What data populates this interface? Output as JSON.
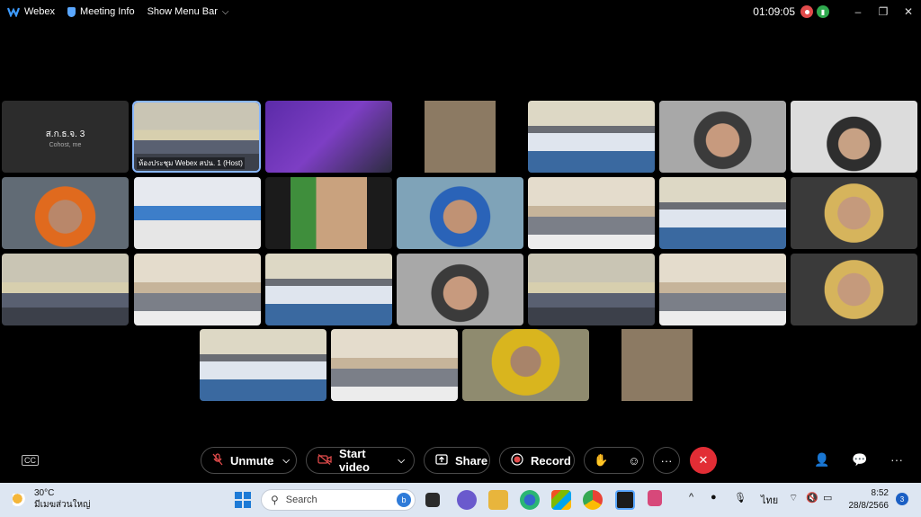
{
  "titlebar": {
    "app_name": "Webex",
    "meeting_info": "Meeting Info",
    "show_menu": "Show Menu Bar",
    "timer": "01:09:05",
    "minimize": "–",
    "restore": "❐",
    "close": "✕"
  },
  "tiles": {
    "self": {
      "name": "ส.ก.ธ.จ. 3",
      "role": "Cohost, me"
    },
    "host": {
      "label": "ห้องประชุม Webex สปน. 1 (Host)"
    }
  },
  "controls": {
    "unmute": "Unmute",
    "start_video": "Start video",
    "share": "Share",
    "record": "Record",
    "more": "···",
    "leave": "✕",
    "participants": "👤",
    "chat": "💬",
    "panel_more": "···",
    "captions": "CC"
  },
  "taskbar": {
    "temperature": "30°C",
    "weather_desc": "มีเมฆส่วนใหญ่",
    "search_placeholder": "Search",
    "language": "ไทย",
    "time": "8:52",
    "date": "28/8/2566",
    "notifications": "3"
  }
}
